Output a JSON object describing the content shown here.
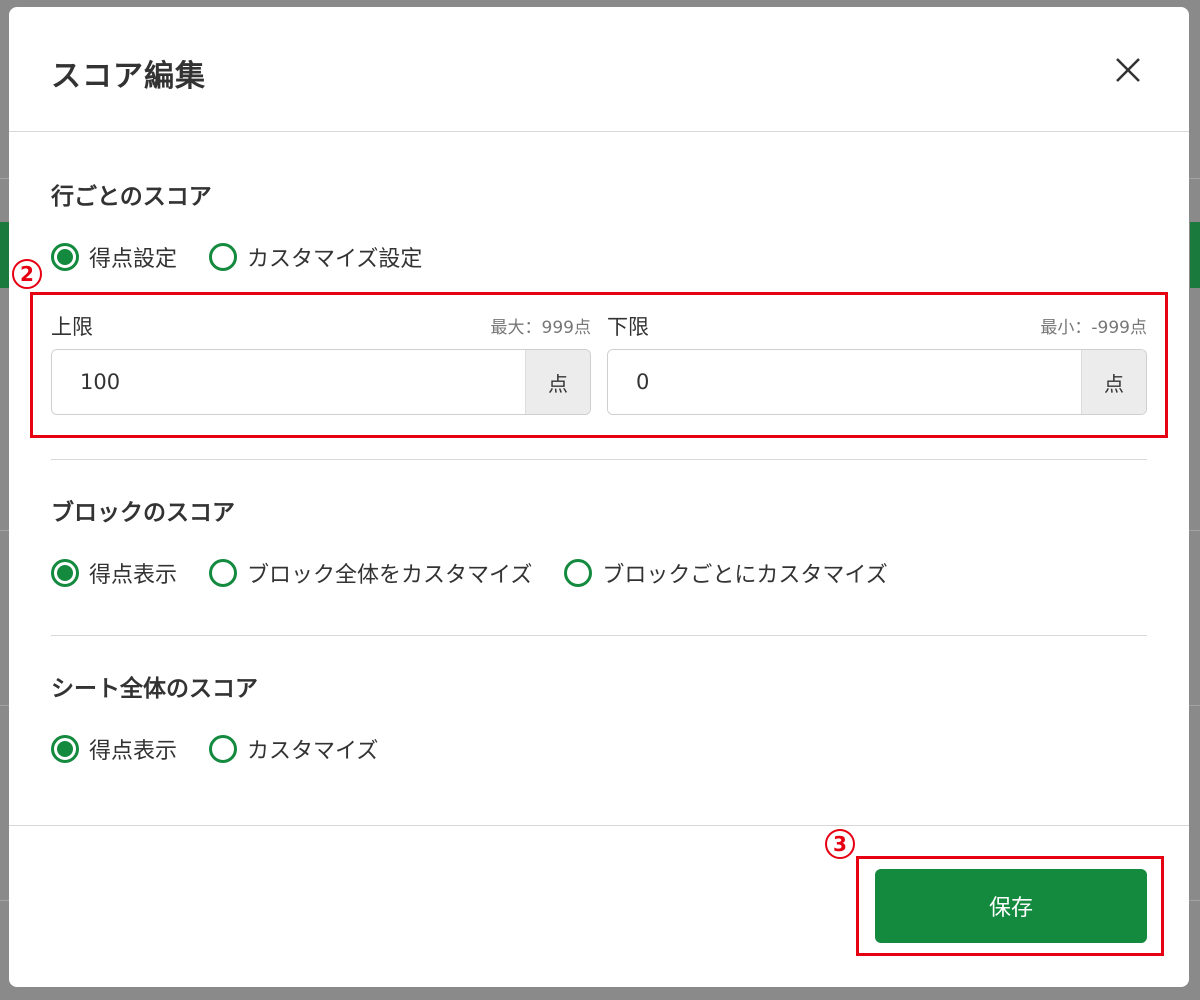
{
  "modal": {
    "title": "スコア編集"
  },
  "row_score": {
    "title": "行ごとのスコア",
    "options": [
      {
        "label": "得点設定",
        "selected": true
      },
      {
        "label": "カスタマイズ設定",
        "selected": false
      }
    ],
    "upper": {
      "label": "上限",
      "hint": "最大：999点",
      "value": "100",
      "unit": "点"
    },
    "lower": {
      "label": "下限",
      "hint": "最小：-999点",
      "value": "0",
      "unit": "点"
    }
  },
  "block_score": {
    "title": "ブロックのスコア",
    "options": [
      {
        "label": "得点表示",
        "selected": true
      },
      {
        "label": "ブロック全体をカスタマイズ",
        "selected": false
      },
      {
        "label": "ブロックごとにカスタマイズ",
        "selected": false
      }
    ]
  },
  "sheet_score": {
    "title": "シート全体のスコア",
    "options": [
      {
        "label": "得点表示",
        "selected": true
      },
      {
        "label": "カスタマイズ",
        "selected": false
      }
    ]
  },
  "footer": {
    "save_label": "保存"
  },
  "annotations": {
    "marker_2": "2",
    "marker_3": "3"
  },
  "colors": {
    "accent": "#138a3e",
    "annotation": "#e60012"
  }
}
